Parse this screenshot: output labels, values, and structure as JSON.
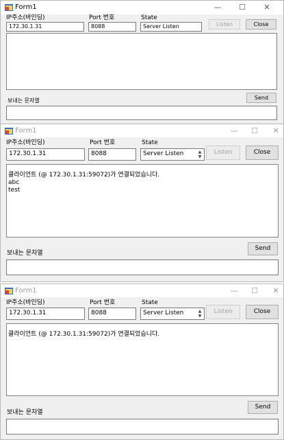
{
  "window": {
    "title": "Form1",
    "minimize": "—",
    "maximize": "☐",
    "close": "✕"
  },
  "labels": {
    "ip": "IP주소(바인딩)",
    "port": "Port 번호",
    "state": "State",
    "send_text": "보내는 문자열"
  },
  "fields": {
    "ip": "172.30.1.31",
    "port": "8088",
    "state": "Server Listen",
    "send": ""
  },
  "buttons": {
    "listen": "Listen",
    "close": "Close",
    "send": "Send"
  },
  "panels": [
    {
      "active": true,
      "log": []
    },
    {
      "active": false,
      "log": [
        "클라이언트 (@ 172.30.1.31:59072)가 연결되었습니다.",
        "abc",
        "test"
      ]
    },
    {
      "active": false,
      "log": [
        "클라이언트 (@ 172.30.1.31:59072)가 연결되었습니다."
      ]
    }
  ],
  "colors": {
    "form_bg": "#f0f0f0",
    "titlebar_bg": "#ffffff",
    "textbox_border": "#7a7a7a"
  }
}
